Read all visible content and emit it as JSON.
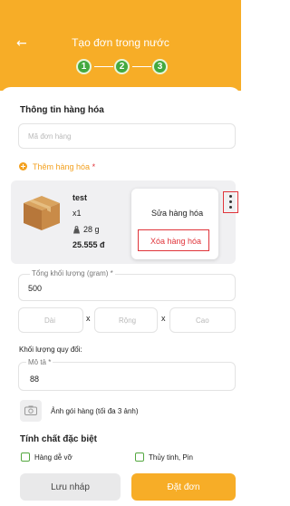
{
  "header": {
    "title": "Tạo đơn trong nước",
    "back_glyph": "←",
    "steps": [
      "1",
      "2",
      "3"
    ]
  },
  "goods": {
    "section_title": "Thông tin hàng hóa",
    "order_code_placeholder": "Mã đơn hàng",
    "add_goods_label": "Thêm hàng hóa",
    "required_mark": "*"
  },
  "product": {
    "name": "test",
    "quantity": "x1",
    "weight": "28 g",
    "price": "25.555 đ",
    "menu_icon": "more-vertical-icon"
  },
  "menu": {
    "edit": "Sửa hàng hóa",
    "delete": "Xóa hàng hóa"
  },
  "weight": {
    "label": "Tổng khối lượng (gram) *",
    "value": "500"
  },
  "dimensions": {
    "length_placeholder": "Dài",
    "width_placeholder": "Rộng",
    "height_placeholder": "Cao",
    "separator": "x"
  },
  "converted": {
    "label": "Khối lượng quy đổi:"
  },
  "description": {
    "label": "Mô tả *",
    "value": "88"
  },
  "photo": {
    "label": "Ảnh gói hàng (tối đa 3 ảnh)"
  },
  "special": {
    "title": "Tính chất đặc biệt",
    "options": [
      "Hàng dễ vỡ",
      "Thủy tinh, Pin"
    ]
  },
  "footer": {
    "draft": "Lưu nháp",
    "submit": "Đặt đơn"
  },
  "colors": {
    "brand": "#f7ad27",
    "step": "#43a93f",
    "highlight": "#e0343a",
    "delete_text": "#e0343a"
  }
}
